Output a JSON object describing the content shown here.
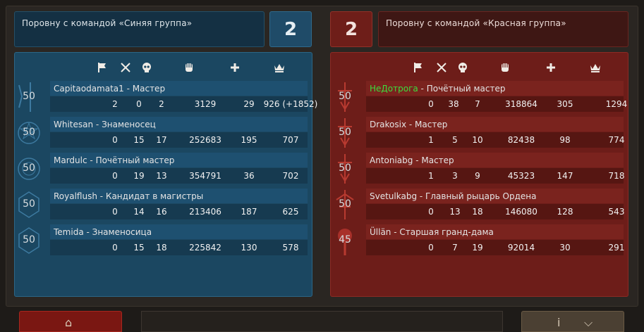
{
  "blue_team": {
    "header": "Поровну  с  командой  «Синяя  группа»",
    "score": "2",
    "players": [
      {
        "name": "Capitaodamata1",
        "sep": " - ",
        "rank": "Мастер",
        "level": "50",
        "flags": "2",
        "kills": "0",
        "deaths": "2",
        "damage": "3129",
        "heal": "29",
        "points": "926 (+1852)"
      },
      {
        "name": "Whitesan",
        "sep": " - ",
        "rank": "Знаменосец",
        "level": "50",
        "flags": "0",
        "kills": "15",
        "deaths": "17",
        "damage": "252683",
        "heal": "195",
        "points": "707"
      },
      {
        "name": "Mardulc",
        "sep": " - ",
        "rank": "Почётный  мастер",
        "level": "50",
        "flags": "0",
        "kills": "19",
        "deaths": "13",
        "damage": "354791",
        "heal": "36",
        "points": "702"
      },
      {
        "name": "Royalflush",
        "sep": " - ",
        "rank": "Кандидат  в  магистры",
        "level": "50",
        "flags": "0",
        "kills": "14",
        "deaths": "16",
        "damage": "213406",
        "heal": "187",
        "points": "625"
      },
      {
        "name": "Temida",
        "sep": " - ",
        "rank": "Знаменосица",
        "level": "50",
        "flags": "0",
        "kills": "15",
        "deaths": "18",
        "damage": "225842",
        "heal": "130",
        "points": "578"
      }
    ]
  },
  "red_team": {
    "header": "Поровну  с  командой  «Красная  группа»",
    "score": "2",
    "players": [
      {
        "name": "НеДотрога",
        "sep": " - ",
        "rank": "Почётный  мастер",
        "level": "50",
        "flags": "0",
        "kills": "38",
        "deaths": "7",
        "damage": "318864",
        "heal": "305",
        "points": "1294",
        "highlight": true
      },
      {
        "name": "Drakosix",
        "sep": " - ",
        "rank": "Мастер",
        "level": "50",
        "flags": "1",
        "kills": "5",
        "deaths": "10",
        "damage": "82438",
        "heal": "98",
        "points": "774"
      },
      {
        "name": "Antoniabg",
        "sep": " - ",
        "rank": "Мастер",
        "level": "50",
        "flags": "1",
        "kills": "3",
        "deaths": "9",
        "damage": "45323",
        "heal": "147",
        "points": "718"
      },
      {
        "name": "Svetulkabg",
        "sep": " - ",
        "rank": "Главный  рыцарь  Ордена",
        "level": "50",
        "flags": "0",
        "kills": "13",
        "deaths": "18",
        "damage": "146080",
        "heal": "128",
        "points": "543"
      },
      {
        "name": "Üllän",
        "sep": " - ",
        "rank": "Старшая  гранд-дама",
        "level": "45",
        "flags": "0",
        "kills": "7",
        "deaths": "19",
        "damage": "92014",
        "heal": "30",
        "points": "291"
      }
    ]
  },
  "columns": {
    "flag": "flag-icon",
    "kills": "crossed-swords-icon",
    "deaths": "skull-icon",
    "damage": "fist-icon",
    "heal": "plus-icon",
    "points": "crown-icon"
  },
  "colors": {
    "blue_panel": "#1b4761",
    "red_panel": "#6d1d19",
    "highlight_name": "#3ddc3d"
  }
}
